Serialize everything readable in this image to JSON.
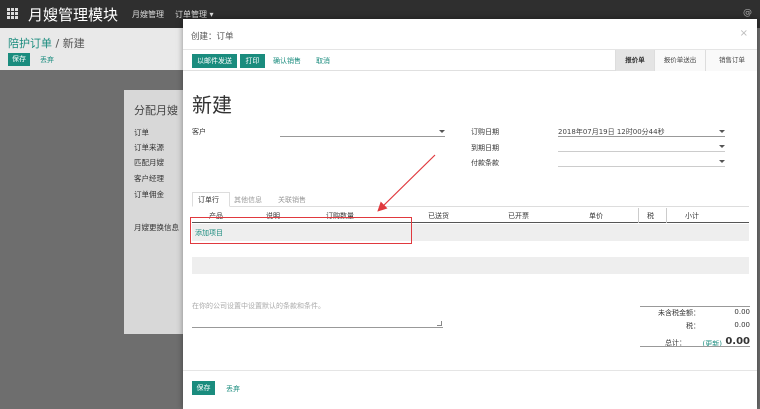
{
  "navbar": {
    "brand": "月嫂管理模块",
    "menu_1": "月嫂管理",
    "menu_2": "订单管理 ▾",
    "right": "@"
  },
  "background": {
    "breadcrumb_link": "陪护订单",
    "breadcrumb_sep": " / ",
    "breadcrumb_current": "新建",
    "save_label": "保存",
    "discard_label": "丢弃",
    "sheet_title": "分配月嫂",
    "labels": [
      "订单",
      "订单来源",
      "匹配月嫂",
      "客户经理",
      "订单佣金",
      "月嫂更换信息"
    ]
  },
  "modal": {
    "title": "创建：订单",
    "close": "×",
    "buttons": {
      "send_email": "以邮件发送",
      "print": "打印",
      "confirm_sale": "确认销售",
      "cancel": "取消"
    },
    "stages": [
      "报价单",
      "报价单送出",
      "销售订单"
    ],
    "doc_title": "新建",
    "fields": {
      "customer_label": "客户",
      "customer_value": "",
      "order_date_label": "订购日期",
      "order_date_value": "2018年07月19日 12时00分44秒",
      "validity_label": "到期日期",
      "validity_value": "",
      "payment_terms_label": "付款条款",
      "payment_terms_value": ""
    },
    "tabs": [
      "订单行",
      "其他信息",
      "关联销售"
    ],
    "columns": [
      "产品",
      "说明",
      "订购数量",
      "已送货",
      "已开票",
      "单价",
      "税",
      "小计"
    ],
    "add_item": "添加项目",
    "notes_placeholder": "在你的公司设置中设置默认的条款和条件。",
    "totals": {
      "untaxed_label": "未含税金额：",
      "untaxed_value": "0.00",
      "tax_label": "税：",
      "tax_value": "0.00",
      "total_label": "总计：",
      "update_label": "(更新)",
      "total_value": "0.00"
    },
    "footer": {
      "save": "保存",
      "discard": "丢弃"
    }
  },
  "colors": {
    "accent": "#1a8c7e",
    "navbar": "#2f2f2f",
    "highlight": "#e0393e"
  }
}
